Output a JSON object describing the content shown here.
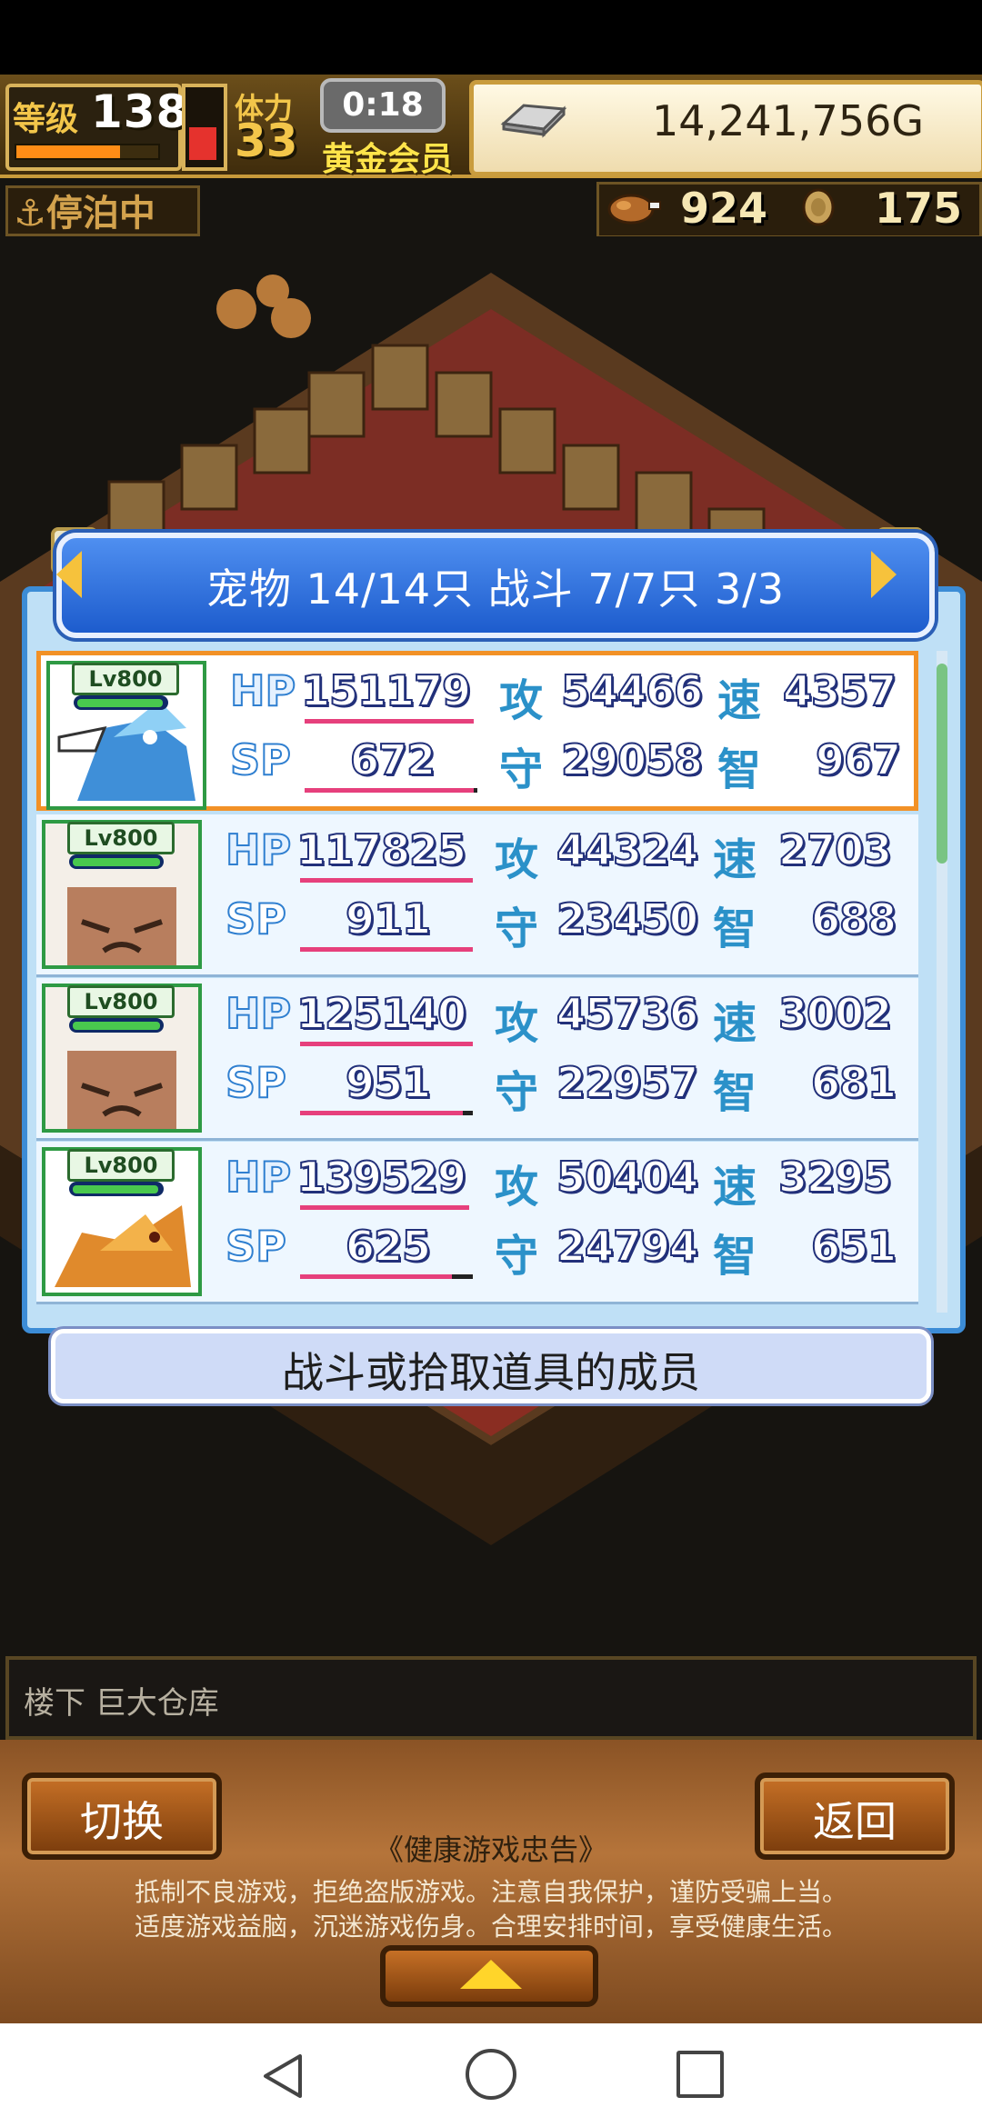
{
  "hud": {
    "level_label": "等级",
    "level": "138",
    "level_progress": 0.75,
    "stamina_label": "体力",
    "stamina": "33",
    "stamina_fill": 0.4,
    "clock": "0:18",
    "membership": "黄金会员",
    "gold": "14,241,756G",
    "status": "⚓停泊中",
    "resource1": "924",
    "resource2": "175"
  },
  "panel": {
    "title": "宠物 14/14只 战斗 7/7只  3/3",
    "caption": "战斗或拾取道具的成员",
    "labels": {
      "hp": "HP",
      "sp": "SP",
      "atk": "攻",
      "def": "守",
      "spd": "速",
      "int": "智"
    },
    "pets": [
      {
        "level": "Lv800",
        "hp": "151179",
        "sp": "672",
        "atk": "54466",
        "def": "29058",
        "spd": "4357",
        "int": "967",
        "hp_ratio": 0.98,
        "sp_ratio": 0.98,
        "portrait": "blue-dragon",
        "selected": true
      },
      {
        "level": "Lv800",
        "hp": "117825",
        "sp": "911",
        "atk": "44324",
        "def": "23450",
        "spd": "2703",
        "int": "688",
        "hp_ratio": 1.0,
        "sp_ratio": 1.0,
        "portrait": "stone-golem",
        "selected": false
      },
      {
        "level": "Lv800",
        "hp": "125140",
        "sp": "951",
        "atk": "45736",
        "def": "22957",
        "spd": "3002",
        "int": "681",
        "hp_ratio": 1.0,
        "sp_ratio": 0.94,
        "portrait": "stone-golem",
        "selected": false
      },
      {
        "level": "Lv800",
        "hp": "139529",
        "sp": "625",
        "atk": "50404",
        "def": "24794",
        "spd": "3295",
        "int": "651",
        "hp_ratio": 0.98,
        "sp_ratio": 0.88,
        "portrait": "orange-dragon",
        "selected": false
      }
    ]
  },
  "location": "楼下 巨大仓库",
  "bottom": {
    "switch_button": "切换",
    "back_button": "返回",
    "health_title": "《健康游戏忠告》",
    "health_line1": "抵制不良游戏，拒绝盗版游戏。注意自我保护，谨防受骗上当。",
    "health_line2": "适度游戏益脑，沉迷游戏伤身。合理安排时间，享受健康生活。"
  },
  "colors": {
    "accent": "#3c8cd6",
    "hp_bar": "#e6407c",
    "selected_border": "#f29126"
  }
}
